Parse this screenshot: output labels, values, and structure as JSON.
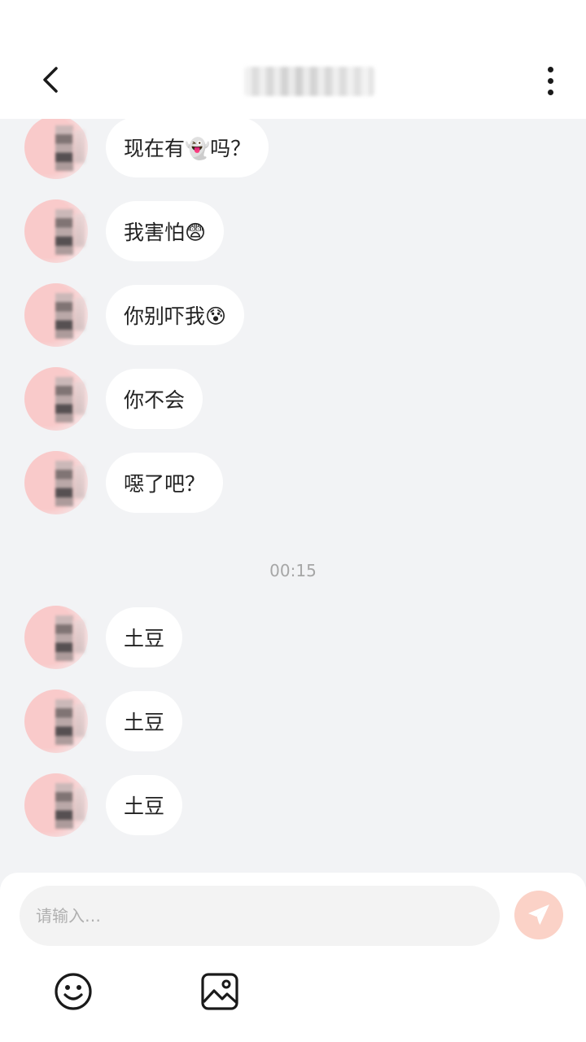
{
  "header": {
    "title": "••••••••"
  },
  "messages": [
    {
      "text": "现在有👻吗？"
    },
    {
      "text": "我害怕😨"
    },
    {
      "text": "你别吓我😰"
    },
    {
      "text": "你不会"
    },
    {
      "text": "噁了吧？"
    },
    {
      "text": "土豆"
    },
    {
      "text": "土豆"
    },
    {
      "text": "土豆"
    }
  ],
  "timestamp": "00:15",
  "composer": {
    "placeholder": "请输入…"
  },
  "icons": {
    "back": "chevron-left-icon",
    "more": "vertical-dots-icon",
    "send": "paper-plane-icon",
    "emoji": "smiley-face-icon",
    "image": "image-icon"
  },
  "colors": {
    "background": "#f2f3f5",
    "bubble": "#ffffff",
    "send_button": "#fbd2c7",
    "send_arrow": "#ffffff"
  }
}
